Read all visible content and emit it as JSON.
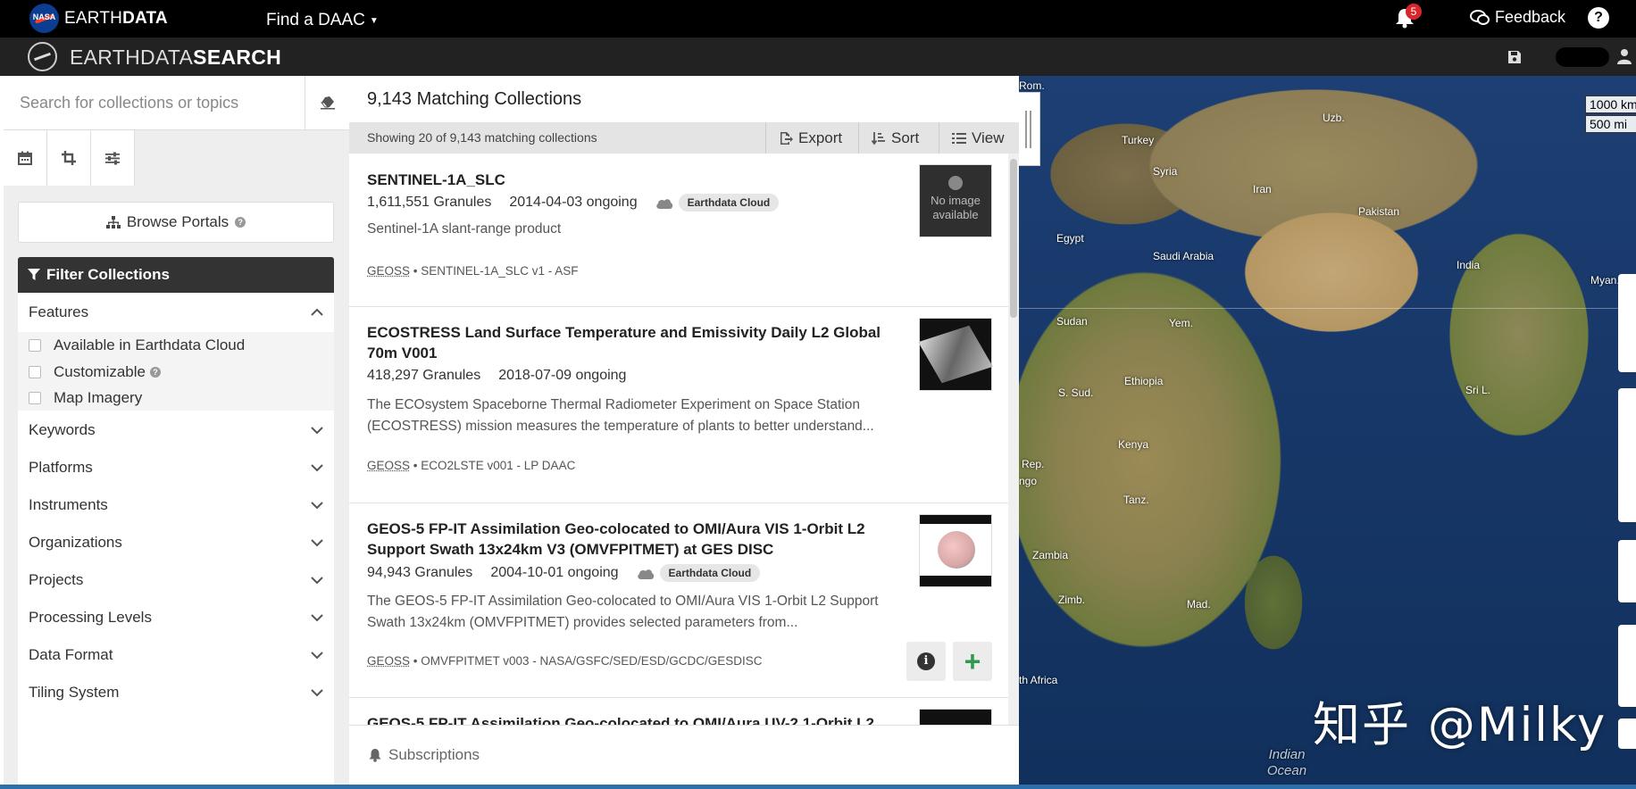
{
  "header": {
    "nasa_logo_text": "NASA",
    "brand_light": "EARTH",
    "brand_bold": "DATA",
    "find_daac": "Find a DAAC",
    "notification_count": "5",
    "feedback": "Feedback",
    "help": "?"
  },
  "search_header": {
    "brand_light": "EARTHDATA",
    "brand_bold": "SEARCH"
  },
  "sidebar": {
    "search_placeholder": "Search for collections or topics",
    "browse_portals": "Browse Portals",
    "filter_title": "Filter Collections",
    "features": {
      "label": "Features",
      "options": [
        {
          "label": "Available in Earthdata Cloud",
          "checked": false
        },
        {
          "label": "Customizable",
          "checked": false
        },
        {
          "label": "Map Imagery",
          "checked": false
        }
      ]
    },
    "facets": [
      "Keywords",
      "Platforms",
      "Instruments",
      "Organizations",
      "Projects",
      "Processing Levels",
      "Data Format",
      "Tiling System"
    ]
  },
  "results": {
    "title": "9,143 Matching Collections",
    "showing": "Showing 20 of 9,143 matching collections",
    "export": "Export",
    "sort": "Sort",
    "view": "View",
    "items": [
      {
        "title": "SENTINEL-1A_SLC",
        "granules": "1,611,551 Granules",
        "dates": "2014-04-03 ongoing",
        "badge": "Earthdata Cloud",
        "description": "Sentinel-1A slant-range product",
        "source_prefix": "GEOSS",
        "source": " • SENTINEL-1A_SLC v1 - ASF",
        "thumb_text": "No image available"
      },
      {
        "title": "ECOSTRESS Land Surface Temperature and Emissivity Daily L2 Global 70m V001",
        "granules": "418,297 Granules",
        "dates": "2018-07-09 ongoing",
        "description": "The ECOsystem Spaceborne Thermal Radiometer Experiment on Space Station (ECOSTRESS) mission measures the temperature of plants to better understand...",
        "source_prefix": "GEOSS",
        "source": " • ECO2LSTE v001 - LP DAAC"
      },
      {
        "title": "GEOS-5 FP-IT Assimilation Geo-colocated to OMI/Aura VIS 1-Orbit L2 Support Swath 13x24km V3 (OMVFPITMET) at GES DISC",
        "granules": "94,943 Granules",
        "dates": "2004-10-01 ongoing",
        "badge": "Earthdata Cloud",
        "description": "The GEOS-5 FP-IT Assimilation Geo-colocated to OMI/Aura VIS 1-Orbit L2 Support Swath 13x24km (OMVFPITMET) provides selected parameters from...",
        "source_prefix": "GEOSS",
        "source": " • OMVFPITMET v003 - NASA/GSFC/SED/ESD/GCDC/GESDISC"
      },
      {
        "title": "GEOS-5 FP-IT Assimilation Geo-colocated to OMI/Aura UV-2 1-Orbit L2"
      }
    ],
    "subscriptions": "Subscriptions"
  },
  "map": {
    "scale_km": "1000 km",
    "scale_mi": "500 mi",
    "labels": [
      "Rom.",
      "Uzb.",
      "Turkey",
      "Syria",
      "Iran",
      "Pakistan",
      "Egypt",
      "Saudi Arabia",
      "India",
      "Myan.",
      "Sudan",
      "Yem.",
      "S. Sud.",
      "Ethiopia",
      "Sri L.",
      "Rep.",
      "ngo",
      "Kenya",
      "Tanz.",
      "Zambia",
      "Zimb.",
      "Mad.",
      "th Africa"
    ],
    "ocean_label": "Indian Ocean"
  },
  "watermark": "知乎 @Milky"
}
